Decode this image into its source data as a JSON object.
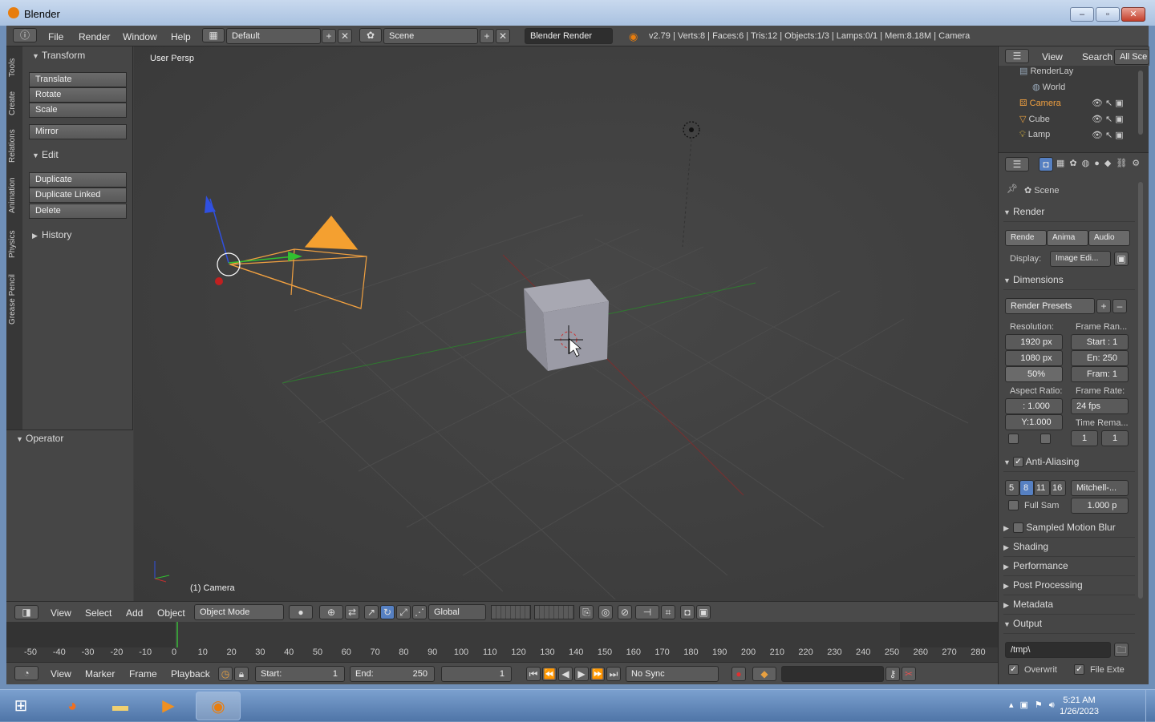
{
  "window": {
    "title": "Blender"
  },
  "info": {
    "menus": [
      "File",
      "Render",
      "Window",
      "Help"
    ],
    "layout": "Default",
    "scene": "Scene",
    "engine": "Blender Render",
    "stats": "v2.79 | Verts:8 | Faces:6 | Tris:12 | Objects:1/3 | Lamps:0/1 | Mem:8.18M | Camera"
  },
  "toolshelf": {
    "tabs": [
      "Tools",
      "Create",
      "Relations",
      "Animation",
      "Physics",
      "Grease Pencil"
    ],
    "transform_title": "Transform",
    "transform_buttons": [
      "Translate",
      "Rotate",
      "Scale"
    ],
    "mirror": "Mirror",
    "edit_title": "Edit",
    "edit_buttons": [
      "Duplicate",
      "Duplicate Linked",
      "Delete"
    ],
    "history_title": "History",
    "operator_title": "Operator"
  },
  "viewport": {
    "view_name": "User Persp",
    "selected": "(1) Camera"
  },
  "vpheader": {
    "menus": [
      "View",
      "Select",
      "Add",
      "Object"
    ],
    "mode": "Object Mode",
    "orientation": "Global"
  },
  "timeline": {
    "ticks": [
      "-50",
      "-40",
      "-30",
      "-20",
      "-10",
      "0",
      "10",
      "20",
      "30",
      "40",
      "50",
      "60",
      "70",
      "80",
      "90",
      "100",
      "110",
      "120",
      "130",
      "140",
      "150",
      "160",
      "170",
      "180",
      "190",
      "200",
      "210",
      "220",
      "230",
      "240",
      "250",
      "260",
      "270",
      "280"
    ],
    "menus": [
      "View",
      "Marker",
      "Frame",
      "Playback"
    ],
    "start_label": "Start:",
    "start_value": "1",
    "end_label": "End:",
    "end_value": "250",
    "current": "1",
    "sync": "No Sync"
  },
  "outliner": {
    "menus": [
      "View",
      "Search"
    ],
    "filter": "All Sce",
    "items": [
      "RenderLay",
      "World",
      "Camera",
      "Cube",
      "Lamp"
    ]
  },
  "props": {
    "scene": "Scene",
    "render_title": "Render",
    "render_buttons": [
      "Rende",
      "Anima",
      "Audio"
    ],
    "display_label": "Display:",
    "display_value": "Image Edi...",
    "dimensions_title": "Dimensions",
    "presets": "Render Presets",
    "resolution_label": "Resolution:",
    "res_x": "1920 px",
    "res_y": "1080 px",
    "res_pct": "50%",
    "frame_range_label": "Frame Ran...",
    "frame_start": "Start : 1",
    "frame_end": "En: 250",
    "frame_step": "Fram: 1",
    "aspect_label": "Aspect Ratio:",
    "aspect_x": ": 1.000",
    "aspect_y": "Y:1.000",
    "framerate_label": "Frame Rate:",
    "framerate": "24 fps",
    "time_remap_label": "Time Rema...",
    "remap_old": "1",
    "remap_new": "1",
    "aa_title": "Anti-Aliasing",
    "aa_samples": [
      "5",
      "8",
      "11",
      "16"
    ],
    "aa_filter": "Mitchell-...",
    "full_sample": "Full Sam",
    "filter_size": "1.000 p",
    "motion_blur": "Sampled Motion Blur",
    "shading": "Shading",
    "performance": "Performance",
    "post": "Post Processing",
    "metadata": "Metadata",
    "output": "Output",
    "output_path": "/tmp\\",
    "overwrite": "Overwrit",
    "file_ext": "File Exte"
  },
  "taskbar": {
    "time": "5:21 AM",
    "date": "1/26/2023"
  }
}
